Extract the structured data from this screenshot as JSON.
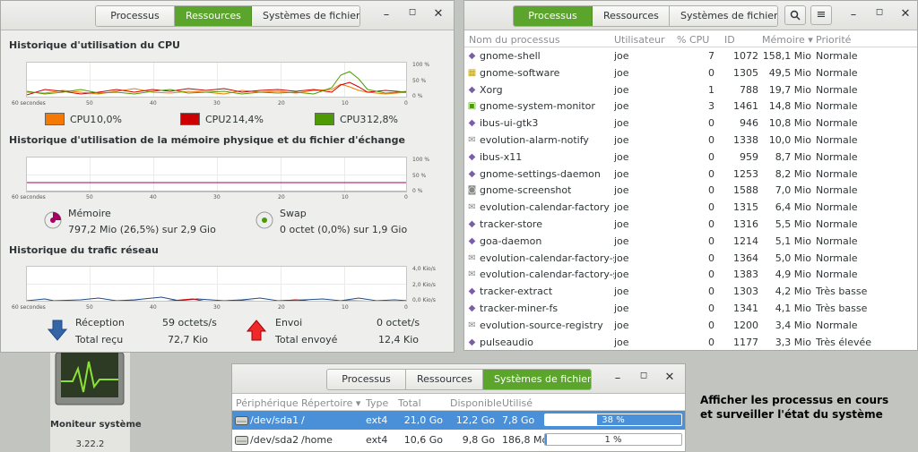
{
  "resources_window": {
    "tabs": [
      "Processus",
      "Ressources",
      "Systèmes de fichiers"
    ],
    "active_tab": 1,
    "cpu": {
      "title": "Historique d'utilisation du CPU",
      "x_ticks": [
        "60 secondes",
        "50",
        "40",
        "30",
        "20",
        "10",
        "0"
      ],
      "y_ticks": [
        "100 %",
        "50 %",
        "0 %"
      ],
      "legend": [
        {
          "label": "CPU1",
          "value": "0,0%",
          "color": "#f57900"
        },
        {
          "label": "CPU2",
          "value": "14,4%",
          "color": "#cc0000"
        },
        {
          "label": "CPU3",
          "value": "12,8%",
          "color": "#4e9a06"
        }
      ]
    },
    "memory": {
      "title": "Historique d'utilisation de la mémoire physique et du fichier d'échange",
      "x_ticks": [
        "60 secondes",
        "50",
        "40",
        "30",
        "20",
        "10",
        "0"
      ],
      "y_ticks": [
        "100 %",
        "50 %",
        "0 %"
      ],
      "mem_label": "Mémoire",
      "mem_value": "797,2 Mio (26,5%) sur 2,9 Gio",
      "mem_color": "#a40062",
      "swap_label": "Swap",
      "swap_value": "0 octet (0,0%) sur 1,9 Gio",
      "swap_color": "#4e9a06"
    },
    "network": {
      "title": "Historique du trafic réseau",
      "x_ticks": [
        "60 secondes",
        "50",
        "40",
        "30",
        "20",
        "10",
        "0"
      ],
      "y_ticks": [
        "4,0 Kio/s",
        "2,0 Kio/s",
        "0,0 Kio/s"
      ],
      "receive_label": "Réception",
      "receive_rate": "59 octets/s",
      "total_received_label": "Total reçu",
      "total_received": "72,7 Kio",
      "send_label": "Envoi",
      "send_rate": "0 octet/s",
      "total_sent_label": "Total envoyé",
      "total_sent": "12,4 Kio"
    }
  },
  "process_window": {
    "tabs": [
      "Processus",
      "Ressources",
      "Systèmes de fichiers"
    ],
    "active_tab": 0,
    "columns": [
      "Nom du processus",
      "Utilisateur",
      "% CPU",
      "ID",
      "Mémoire ▾",
      "Priorité"
    ],
    "rows": [
      {
        "name": "gnome-shell",
        "user": "joe",
        "cpu": "7",
        "id": "1072",
        "mem": "158,1 Mio",
        "prio": "Normale",
        "icon": "diamond-icon"
      },
      {
        "name": "gnome-software",
        "user": "joe",
        "cpu": "0",
        "id": "1305",
        "mem": "49,5 Mio",
        "prio": "Normale",
        "icon": "software-icon"
      },
      {
        "name": "Xorg",
        "user": "joe",
        "cpu": "1",
        "id": "788",
        "mem": "19,7 Mio",
        "prio": "Normale",
        "icon": "diamond-icon"
      },
      {
        "name": "gnome-system-monitor",
        "user": "joe",
        "cpu": "3",
        "id": "1461",
        "mem": "14,8 Mio",
        "prio": "Normale",
        "icon": "monitor-icon"
      },
      {
        "name": "ibus-ui-gtk3",
        "user": "joe",
        "cpu": "0",
        "id": "946",
        "mem": "10,8 Mio",
        "prio": "Normale",
        "icon": "diamond-icon"
      },
      {
        "name": "evolution-alarm-notify",
        "user": "joe",
        "cpu": "0",
        "id": "1338",
        "mem": "10,0 Mio",
        "prio": "Normale",
        "icon": "mail-icon"
      },
      {
        "name": "ibus-x11",
        "user": "joe",
        "cpu": "0",
        "id": "959",
        "mem": "8,7 Mio",
        "prio": "Normale",
        "icon": "diamond-icon"
      },
      {
        "name": "gnome-settings-daemon",
        "user": "joe",
        "cpu": "0",
        "id": "1253",
        "mem": "8,2 Mio",
        "prio": "Normale",
        "icon": "diamond-icon"
      },
      {
        "name": "gnome-screenshot",
        "user": "joe",
        "cpu": "0",
        "id": "1588",
        "mem": "7,0 Mio",
        "prio": "Normale",
        "icon": "camera-icon"
      },
      {
        "name": "evolution-calendar-factory",
        "user": "joe",
        "cpu": "0",
        "id": "1315",
        "mem": "6,4 Mio",
        "prio": "Normale",
        "icon": "mail-icon"
      },
      {
        "name": "tracker-store",
        "user": "joe",
        "cpu": "0",
        "id": "1316",
        "mem": "5,5 Mio",
        "prio": "Normale",
        "icon": "diamond-icon"
      },
      {
        "name": "goa-daemon",
        "user": "joe",
        "cpu": "0",
        "id": "1214",
        "mem": "5,1 Mio",
        "prio": "Normale",
        "icon": "diamond-icon"
      },
      {
        "name": "evolution-calendar-factory-subp",
        "user": "joe",
        "cpu": "0",
        "id": "1364",
        "mem": "5,0 Mio",
        "prio": "Normale",
        "icon": "mail-icon"
      },
      {
        "name": "evolution-calendar-factory-subp",
        "user": "joe",
        "cpu": "0",
        "id": "1383",
        "mem": "4,9 Mio",
        "prio": "Normale",
        "icon": "mail-icon"
      },
      {
        "name": "tracker-extract",
        "user": "joe",
        "cpu": "0",
        "id": "1303",
        "mem": "4,2 Mio",
        "prio": "Très basse",
        "icon": "diamond-icon"
      },
      {
        "name": "tracker-miner-fs",
        "user": "joe",
        "cpu": "0",
        "id": "1341",
        "mem": "4,1 Mio",
        "prio": "Très basse",
        "icon": "diamond-icon"
      },
      {
        "name": "evolution-source-registry",
        "user": "joe",
        "cpu": "0",
        "id": "1200",
        "mem": "3,4 Mio",
        "prio": "Normale",
        "icon": "mail-icon"
      },
      {
        "name": "pulseaudio",
        "user": "joe",
        "cpu": "0",
        "id": "1177",
        "mem": "3,3 Mio",
        "prio": "Très élevée",
        "icon": "diamond-icon"
      }
    ]
  },
  "filesystem_window": {
    "tabs": [
      "Processus",
      "Ressources",
      "Systèmes de fichiers"
    ],
    "active_tab": 2,
    "columns": [
      "Périphérique",
      "Répertoire ▾",
      "Type",
      "Total",
      "Disponible",
      "Utilisé"
    ],
    "rows": [
      {
        "device": "/dev/sda1",
        "dir": "/",
        "type": "ext4",
        "total": "21,0 Go",
        "avail": "12,2 Go",
        "used": "7,8 Go",
        "pct": "38 %",
        "fraction": 0.38
      },
      {
        "device": "/dev/sda2",
        "dir": "/home",
        "type": "ext4",
        "total": "10,6 Go",
        "avail": "9,8 Go",
        "used": "186,8 Mo",
        "pct": "1 %",
        "fraction": 0.01
      }
    ]
  },
  "app_card": {
    "name": "Moniteur système",
    "version": "3.22.2"
  },
  "caption": {
    "line1": "Afficher les processus en cours",
    "line2": "et surveiller l'état du système"
  }
}
